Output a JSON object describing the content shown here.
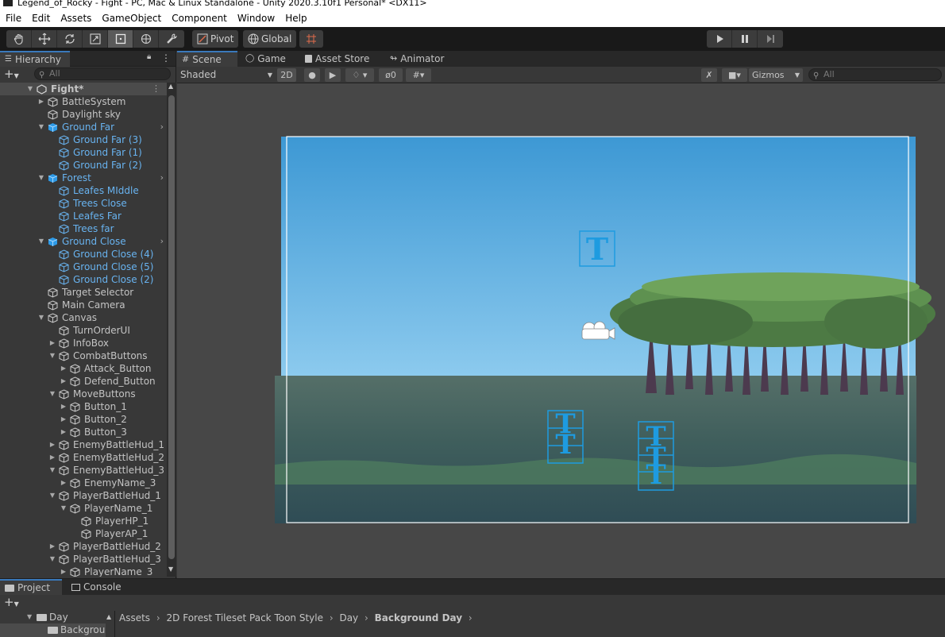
{
  "window": {
    "title": "Legend_of_Rocky - Fight - PC, Mac & Linux Standalone - Unity 2020.3.10f1 Personal* <DX11>"
  },
  "menu": [
    "File",
    "Edit",
    "Assets",
    "GameObject",
    "Component",
    "Window",
    "Help"
  ],
  "toolbar": {
    "pivot_label": "Pivot",
    "global_label": "Global"
  },
  "hierarchy": {
    "tab_label": "Hierarchy",
    "search_placeholder": "All",
    "scene_name": "Fight*",
    "items": [
      {
        "label": "BattleSystem",
        "depth": 1,
        "arrow": "right",
        "blue": false,
        "prefab": false
      },
      {
        "label": "Daylight sky",
        "depth": 1,
        "arrow": "",
        "blue": false,
        "prefab": false
      },
      {
        "label": "Ground Far",
        "depth": 1,
        "arrow": "down",
        "blue": true,
        "prefab": true,
        "chevron": true
      },
      {
        "label": "Ground Far (3)",
        "depth": 2,
        "arrow": "",
        "blue": true,
        "prefab": false
      },
      {
        "label": "Ground Far (1)",
        "depth": 2,
        "arrow": "",
        "blue": true,
        "prefab": false
      },
      {
        "label": "Ground Far (2)",
        "depth": 2,
        "arrow": "",
        "blue": true,
        "prefab": false
      },
      {
        "label": "Forest",
        "depth": 1,
        "arrow": "down",
        "blue": true,
        "prefab": true,
        "chevron": true
      },
      {
        "label": "Leafes MIddle",
        "depth": 2,
        "arrow": "",
        "blue": true,
        "prefab": false
      },
      {
        "label": "Trees Close",
        "depth": 2,
        "arrow": "",
        "blue": true,
        "prefab": false
      },
      {
        "label": "Leafes Far",
        "depth": 2,
        "arrow": "",
        "blue": true,
        "prefab": false
      },
      {
        "label": "Trees far",
        "depth": 2,
        "arrow": "",
        "blue": true,
        "prefab": false
      },
      {
        "label": "Ground Close",
        "depth": 1,
        "arrow": "down",
        "blue": true,
        "prefab": true,
        "chevron": true
      },
      {
        "label": "Ground Close (4)",
        "depth": 2,
        "arrow": "",
        "blue": true,
        "prefab": false
      },
      {
        "label": "Ground Close (5)",
        "depth": 2,
        "arrow": "",
        "blue": true,
        "prefab": false
      },
      {
        "label": "Ground Close (2)",
        "depth": 2,
        "arrow": "",
        "blue": true,
        "prefab": false
      },
      {
        "label": "Target Selector",
        "depth": 1,
        "arrow": "",
        "blue": false,
        "prefab": false
      },
      {
        "label": "Main Camera",
        "depth": 1,
        "arrow": "",
        "blue": false,
        "prefab": false
      },
      {
        "label": "Canvas",
        "depth": 1,
        "arrow": "down",
        "blue": false,
        "prefab": false
      },
      {
        "label": "TurnOrderUI",
        "depth": 2,
        "arrow": "",
        "blue": false,
        "prefab": false
      },
      {
        "label": "InfoBox",
        "depth": 2,
        "arrow": "right",
        "blue": false,
        "prefab": false
      },
      {
        "label": "CombatButtons",
        "depth": 2,
        "arrow": "down",
        "blue": false,
        "prefab": false
      },
      {
        "label": "Attack_Button",
        "depth": 3,
        "arrow": "right",
        "blue": false,
        "prefab": false
      },
      {
        "label": "Defend_Button",
        "depth": 3,
        "arrow": "right",
        "blue": false,
        "prefab": false
      },
      {
        "label": "MoveButtons",
        "depth": 2,
        "arrow": "down",
        "blue": false,
        "prefab": false
      },
      {
        "label": "Button_1",
        "depth": 3,
        "arrow": "right",
        "blue": false,
        "prefab": false
      },
      {
        "label": "Button_2",
        "depth": 3,
        "arrow": "right",
        "blue": false,
        "prefab": false
      },
      {
        "label": "Button_3",
        "depth": 3,
        "arrow": "right",
        "blue": false,
        "prefab": false
      },
      {
        "label": "EnemyBattleHud_1",
        "depth": 2,
        "arrow": "right",
        "blue": false,
        "prefab": false
      },
      {
        "label": "EnemyBattleHud_2",
        "depth": 2,
        "arrow": "right",
        "blue": false,
        "prefab": false
      },
      {
        "label": "EnemyBattleHud_3",
        "depth": 2,
        "arrow": "down",
        "blue": false,
        "prefab": false
      },
      {
        "label": "EnemyName_3",
        "depth": 3,
        "arrow": "right",
        "blue": false,
        "prefab": false
      },
      {
        "label": "PlayerBattleHud_1",
        "depth": 2,
        "arrow": "down",
        "blue": false,
        "prefab": false
      },
      {
        "label": "PlayerName_1",
        "depth": 3,
        "arrow": "down",
        "blue": false,
        "prefab": false
      },
      {
        "label": "PlayerHP_1",
        "depth": 4,
        "arrow": "",
        "blue": false,
        "prefab": false
      },
      {
        "label": "PlayerAP_1",
        "depth": 4,
        "arrow": "",
        "blue": false,
        "prefab": false
      },
      {
        "label": "PlayerBattleHud_2",
        "depth": 2,
        "arrow": "right",
        "blue": false,
        "prefab": false
      },
      {
        "label": "PlayerBattleHud_3",
        "depth": 2,
        "arrow": "down",
        "blue": false,
        "prefab": false
      },
      {
        "label": "PlayerName_3",
        "depth": 3,
        "arrow": "right",
        "blue": false,
        "prefab": false
      }
    ]
  },
  "scene_tabs": [
    {
      "label": "Scene",
      "icon": "grid-icon",
      "selected": true
    },
    {
      "label": "Game",
      "icon": "gamepad-icon",
      "selected": false
    },
    {
      "label": "Asset Store",
      "icon": "bag-icon",
      "selected": false
    },
    {
      "label": "Animator",
      "icon": "animator-icon",
      "selected": false
    }
  ],
  "scene_bar": {
    "shading_mode": "Shaded",
    "mode_2d": "2D",
    "hidden_count": "0",
    "gizmos_label": "Gizmos",
    "search_placeholder": "All"
  },
  "bottom": {
    "tabs": [
      {
        "label": "Project",
        "selected": true
      },
      {
        "label": "Console",
        "selected": false
      }
    ],
    "tree": [
      {
        "label": "Day"
      },
      {
        "label": "Backgrou"
      }
    ],
    "breadcrumb": [
      "Assets",
      "2D Forest Tileset Pack Toon Style",
      "Day",
      "Background Day"
    ]
  },
  "colors": {
    "accent": "#3a79bb",
    "blue_text": "#68b3f0",
    "gizmo": "#1e9be0",
    "sky_top": "#3d98d4",
    "sky_bottom": "#8cc9ee",
    "ground": "#3c5654"
  }
}
